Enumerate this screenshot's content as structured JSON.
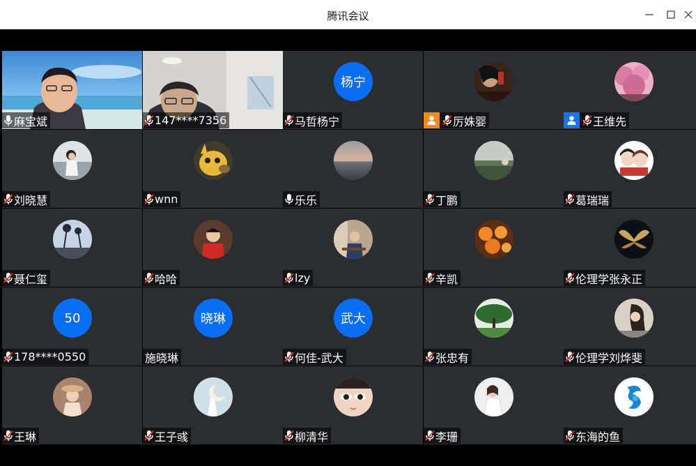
{
  "window": {
    "title": "腾讯会议"
  },
  "participants": [
    {
      "name": "麻宝斌",
      "mic": "on",
      "type": "video-1"
    },
    {
      "name": "147****7356",
      "mic": "muted",
      "type": "video-2"
    },
    {
      "name": "马哲杨宁",
      "mic": "muted",
      "type": "initial",
      "initial": "杨宁"
    },
    {
      "name": "厉姝婴",
      "mic": "muted",
      "type": "avatar",
      "badge": "orange",
      "avatar_style": "dark-portrait"
    },
    {
      "name": "王维先",
      "mic": "muted",
      "type": "avatar",
      "badge": "blue",
      "avatar_style": "pink-blossom"
    },
    {
      "name": "刘晓慧",
      "mic": "muted",
      "type": "avatar",
      "avatar_style": "girl-light"
    },
    {
      "name": "wnn",
      "mic": "muted",
      "type": "avatar",
      "avatar_style": "pikachu"
    },
    {
      "name": "乐乐",
      "mic": "on",
      "type": "avatar",
      "avatar_style": "sea-sunset"
    },
    {
      "name": "丁鹏",
      "mic": "muted",
      "type": "avatar",
      "avatar_style": "landscape"
    },
    {
      "name": "葛瑞瑞",
      "mic": "muted",
      "type": "avatar",
      "avatar_style": "cartoon-couple"
    },
    {
      "name": "聂仁玺",
      "mic": "muted",
      "type": "avatar",
      "avatar_style": "palm-trees"
    },
    {
      "name": "哈哈",
      "mic": "muted",
      "type": "avatar",
      "avatar_style": "child-red"
    },
    {
      "name": "lzy",
      "mic": "muted",
      "type": "avatar",
      "avatar_style": "man-desk"
    },
    {
      "name": "辛凯",
      "mic": "muted",
      "type": "avatar",
      "avatar_style": "orange-balls"
    },
    {
      "name": "伦理学张永正",
      "mic": "muted",
      "type": "avatar",
      "avatar_style": "golden-wings"
    },
    {
      "name": "178****0550",
      "mic": "muted",
      "type": "initial",
      "initial": "50"
    },
    {
      "name": "施晓琳",
      "mic": "none",
      "type": "initial",
      "initial": "晓琳"
    },
    {
      "name": "何佳-武大",
      "mic": "muted",
      "type": "initial",
      "initial": "武大"
    },
    {
      "name": "张忠有",
      "mic": "muted",
      "type": "avatar",
      "avatar_style": "green-tree"
    },
    {
      "name": "伦理学刘烨斐",
      "mic": "muted",
      "type": "avatar",
      "avatar_style": "woman-profile"
    },
    {
      "name": "王琳",
      "mic": "muted",
      "type": "avatar",
      "avatar_style": "girl-hat"
    },
    {
      "name": "王子彧",
      "mic": "muted",
      "type": "avatar",
      "avatar_style": "moon-girl"
    },
    {
      "name": "柳清华",
      "mic": "muted",
      "type": "avatar",
      "avatar_style": "eyes-closeup"
    },
    {
      "name": "李珊",
      "mic": "muted",
      "type": "avatar",
      "avatar_style": "woman-white"
    },
    {
      "name": "东海的鱼",
      "mic": "muted",
      "type": "avatar",
      "avatar_style": "blue-logo"
    }
  ],
  "colors": {
    "tile_bg": "#2b2d31",
    "initial_bg": "#0a6df4",
    "host_badge_orange": "#f28b1c",
    "host_badge_blue": "#1b73f0"
  }
}
